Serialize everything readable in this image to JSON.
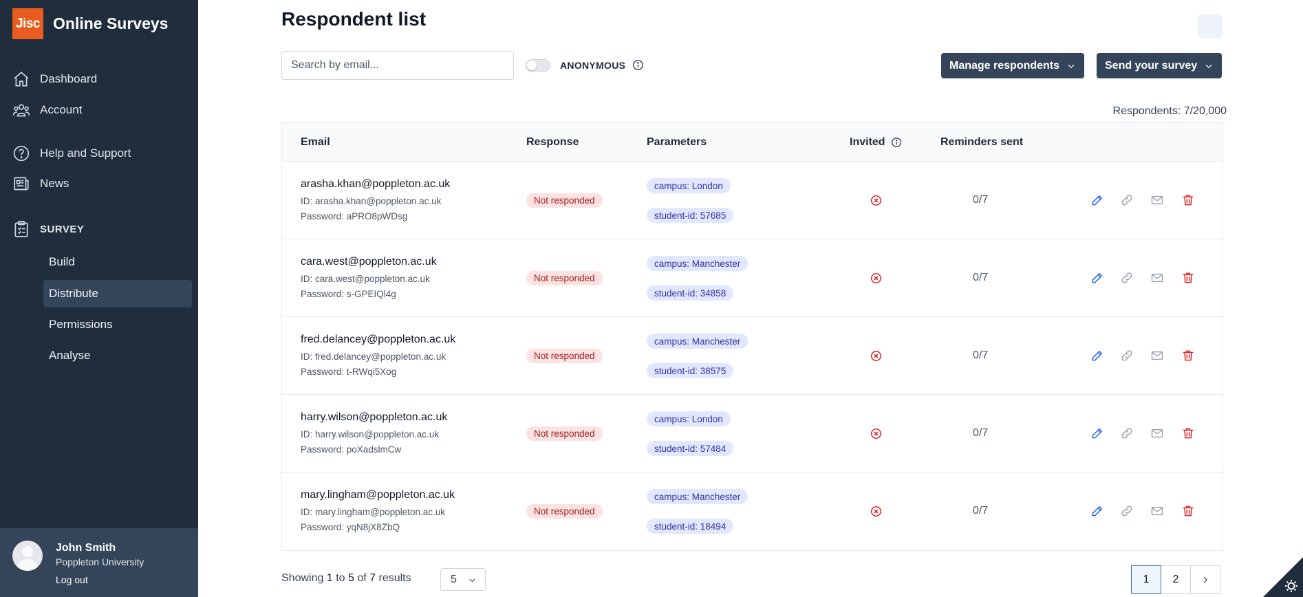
{
  "brand": {
    "logo_text": "Jisc",
    "name": "Online Surveys",
    "logo_color": "#e85d1f"
  },
  "sidebar": {
    "items": [
      {
        "label": "Dashboard",
        "icon": "home-icon"
      },
      {
        "label": "Account",
        "icon": "users-icon"
      },
      {
        "label": "Help and Support",
        "icon": "help-icon"
      },
      {
        "label": "News",
        "icon": "news-icon"
      }
    ],
    "section": {
      "label": "SURVEY",
      "icon": "clipboard-icon"
    },
    "sub_items": [
      {
        "label": "Build",
        "active": false
      },
      {
        "label": "Distribute",
        "active": true
      },
      {
        "label": "Permissions",
        "active": false
      },
      {
        "label": "Analyse",
        "active": false
      }
    ],
    "user": {
      "name": "John Smith",
      "org": "Poppleton University",
      "logout": "Log out"
    }
  },
  "main": {
    "title": "Respondent list",
    "search_placeholder": "Search by email...",
    "anonymous_label": "ANONYMOUS",
    "manage_button": "Manage respondents",
    "send_button": "Send your survey",
    "respondents_count": "Respondents: 7/20,000"
  },
  "table": {
    "headers": {
      "email": "Email",
      "response": "Response",
      "parameters": "Parameters",
      "invited": "Invited",
      "reminders": "Reminders sent"
    },
    "rows": [
      {
        "email": "arasha.khan@poppleton.ac.uk",
        "id": "ID: arasha.khan@poppleton.ac.uk",
        "password": "Password: aPRO8pWDsg",
        "response": "Not responded",
        "param1": "campus: London",
        "param2": "student-id: 57685",
        "reminders": "0/7"
      },
      {
        "email": "cara.west@poppleton.ac.uk",
        "id": "ID: cara.west@poppleton.ac.uk",
        "password": "Password: s-GPEIQl4g",
        "response": "Not responded",
        "param1": "campus: Manchester",
        "param2": "student-id: 34858",
        "reminders": "0/7"
      },
      {
        "email": "fred.delancey@poppleton.ac.uk",
        "id": "ID: fred.delancey@poppleton.ac.uk",
        "password": "Password: t-RWqi5Xog",
        "response": "Not responded",
        "param1": "campus: Manchester",
        "param2": "student-id: 38575",
        "reminders": "0/7"
      },
      {
        "email": "harry.wilson@poppleton.ac.uk",
        "id": "ID: harry.wilson@poppleton.ac.uk",
        "password": "Password: poXadslmCw",
        "response": "Not responded",
        "param1": "campus: London",
        "param2": "student-id: 57484",
        "reminders": "0/7"
      },
      {
        "email": "mary.lingham@poppleton.ac.uk",
        "id": "ID: mary.lingham@poppleton.ac.uk",
        "password": "Password: yqN8jX8ZbQ",
        "response": "Not responded",
        "param1": "campus: Manchester",
        "param2": "student-id: 18494",
        "reminders": "0/7"
      }
    ]
  },
  "footer": {
    "showing_prefix": "Showing",
    "from": "1",
    "to_word": "to",
    "to": "5",
    "of_word": "of",
    "total": "7",
    "results_word": "results",
    "per_page": "5",
    "pages": [
      "1",
      "2"
    ]
  },
  "colors": {
    "sidebar_bg": "#1f2d3d",
    "button_dark": "#34455a",
    "danger": "#dc2626",
    "edit_blue": "#2563eb"
  }
}
